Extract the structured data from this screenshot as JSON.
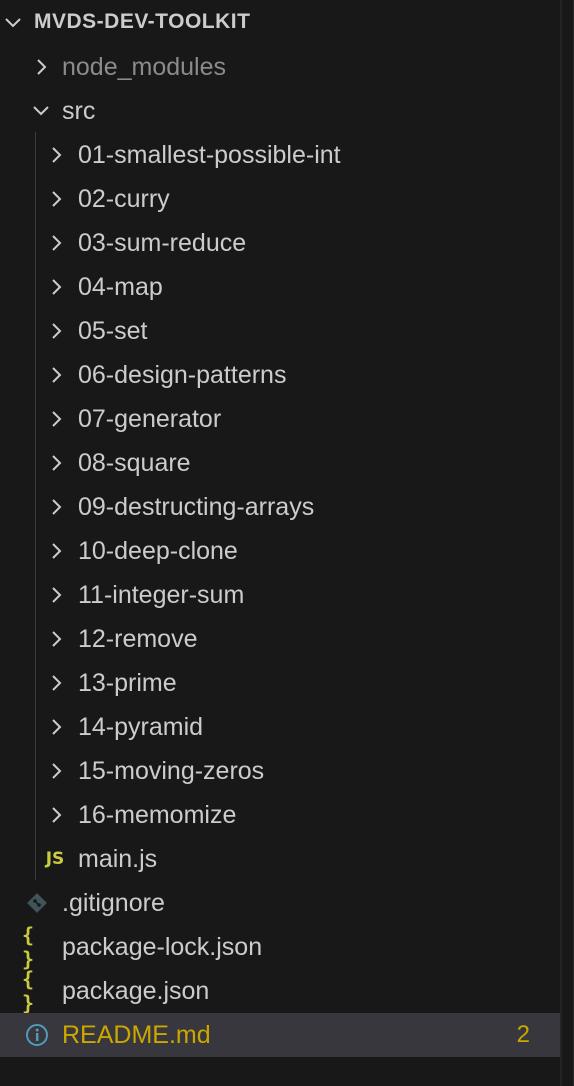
{
  "root": {
    "label": "MVDS-DEV-TOOLKIT",
    "icon": "chevron-down-icon"
  },
  "top_items": {
    "node_modules": {
      "label": "node_modules",
      "icon": "chevron-right-icon"
    },
    "src": {
      "label": "src",
      "icon": "chevron-down-icon"
    }
  },
  "src_items": [
    {
      "label": "01-smallest-possible-int"
    },
    {
      "label": "02-curry"
    },
    {
      "label": "03-sum-reduce"
    },
    {
      "label": "04-map"
    },
    {
      "label": "05-set"
    },
    {
      "label": "06-design-patterns"
    },
    {
      "label": "07-generator"
    },
    {
      "label": "08-square"
    },
    {
      "label": "09-destructing-arrays"
    },
    {
      "label": "10-deep-clone"
    },
    {
      "label": "11-integer-sum"
    },
    {
      "label": "12-remove"
    },
    {
      "label": "13-prime"
    },
    {
      "label": "14-pyramid"
    },
    {
      "label": "15-moving-zeros"
    },
    {
      "label": "16-memomize"
    }
  ],
  "main_js": {
    "label": "main.js",
    "icon_text": "JS"
  },
  "root_files": {
    "gitignore": {
      "label": ".gitignore",
      "icon": "git-diamond-icon"
    },
    "package_lock": {
      "label": "package-lock.json",
      "icon_text": "{ }"
    },
    "package_json": {
      "label": "package.json",
      "icon_text": "{ }"
    },
    "readme": {
      "label": "README.md",
      "icon": "info-icon",
      "badge": "2"
    }
  },
  "colors": {
    "background": "#181818",
    "text": "#cccccc",
    "dim_text": "#8b8b8b",
    "selected_row": "#37373d",
    "warning": "#cca700",
    "json_icon": "#cbcb41"
  }
}
